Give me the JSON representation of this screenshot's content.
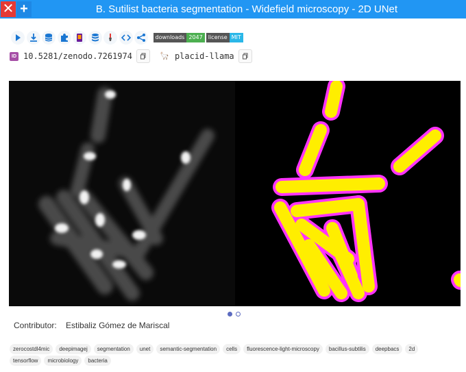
{
  "window": {
    "title": "B. Sutilist bacteria segmentation - Widefield microscopy - 2D UNet",
    "close_icon": "close-icon",
    "add_icon": "plus-icon"
  },
  "toolbar": {
    "icons": [
      "play-icon",
      "download-icon",
      "database-icon",
      "puzzle-icon",
      "app-icon",
      "stack-icon",
      "pipette-icon",
      "code-icon",
      "share-icon"
    ],
    "badges": [
      {
        "label": "downloads",
        "value": "2047",
        "color": "#4caf50"
      },
      {
        "label": "license",
        "value": "MIT",
        "color": "#2ab7e8"
      }
    ]
  },
  "identifiers": {
    "doi_icon": "ID",
    "doi": "10.5281/zenodo.7261974",
    "nickname_icon": "llama-icon",
    "nickname": "placid-llama"
  },
  "gallery": {
    "slides": 2,
    "active": 0,
    "left_image": "fluorescence-microscopy-image",
    "right_image": "segmentation-mask-image"
  },
  "contributor": {
    "label": "Contributor:",
    "name": "Estibaliz Gómez de Mariscal"
  },
  "tags": [
    "zerocostdl4mic",
    "deepimagej",
    "segmentation",
    "unet",
    "semantic-segmentation",
    "cells",
    "fluorescence-light-microscopy",
    "bacillus-subtilis",
    "deepbacs",
    "2d",
    "tensorflow",
    "microbiology",
    "bacteria"
  ]
}
